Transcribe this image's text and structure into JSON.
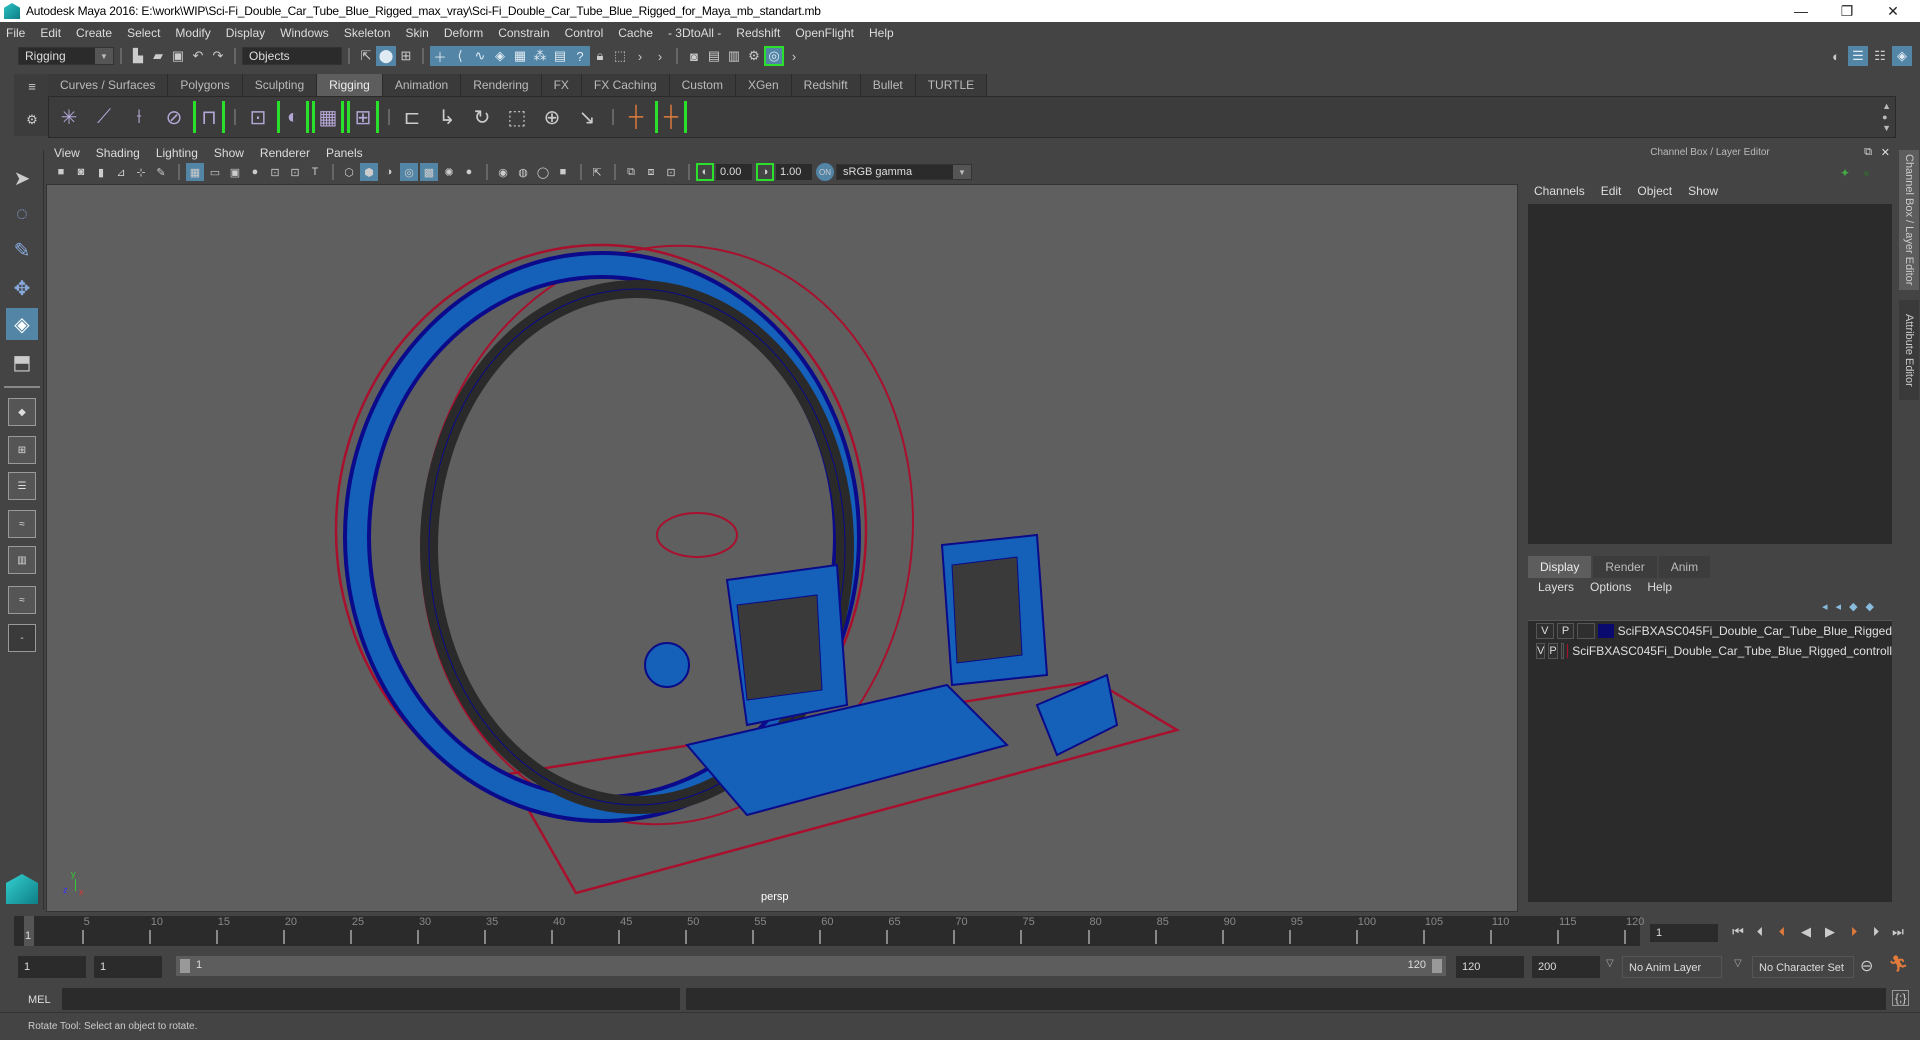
{
  "window": {
    "title": "Autodesk Maya 2016: E:\\work\\WIP\\Sci-Fi_Double_Car_Tube_Blue_Rigged_max_vray\\Sci-Fi_Double_Car_Tube_Blue_Rigged_for_Maya_mb_standart.mb",
    "controls": {
      "minimize": "—",
      "restore": "❐",
      "close": "✕"
    }
  },
  "menubar": [
    "File",
    "Edit",
    "Create",
    "Select",
    "Modify",
    "Display",
    "Windows",
    "Skeleton",
    "Skin",
    "Deform",
    "Constrain",
    "Control",
    "Cache",
    "- 3DtoAll -",
    "Redshift",
    "OpenFlight",
    "Help"
  ],
  "statusline": {
    "menu_set": "Rigging",
    "selection_mode": "Objects"
  },
  "shelf_tabs": [
    {
      "label": "Curves / Surfaces",
      "active": false
    },
    {
      "label": "Polygons",
      "active": false
    },
    {
      "label": "Sculpting",
      "active": false
    },
    {
      "label": "Rigging",
      "active": true
    },
    {
      "label": "Animation",
      "active": false
    },
    {
      "label": "Rendering",
      "active": false
    },
    {
      "label": "FX",
      "active": false
    },
    {
      "label": "FX Caching",
      "active": false
    },
    {
      "label": "Custom",
      "active": false
    },
    {
      "label": "XGen",
      "active": false
    },
    {
      "label": "Redshift",
      "active": false
    },
    {
      "label": "Bullet",
      "active": false
    },
    {
      "label": "TURTLE",
      "active": false
    }
  ],
  "viewport": {
    "menu": [
      "View",
      "Shading",
      "Lighting",
      "Show",
      "Renderer",
      "Panels"
    ],
    "exposure": "0.00",
    "gamma": "1.00",
    "color_space": "sRGB gamma",
    "camera_label": "persp",
    "axis": {
      "y": "y",
      "z": "z",
      "x": "x"
    }
  },
  "channel_box": {
    "title": "Channel Box / Layer Editor",
    "menu": [
      "Channels",
      "Edit",
      "Object",
      "Show"
    ]
  },
  "layer_editor": {
    "tabs": [
      {
        "label": "Display",
        "active": true
      },
      {
        "label": "Render",
        "active": false
      },
      {
        "label": "Anim",
        "active": false
      }
    ],
    "menu": [
      "Layers",
      "Options",
      "Help"
    ],
    "layers": [
      {
        "v": "V",
        "p": "P",
        "color": "#0a0a6e",
        "name": "SciFBXASC045Fi_Double_Car_Tube_Blue_Rigged"
      },
      {
        "v": "V",
        "p": "P",
        "color": "#a8102e",
        "name": "SciFBXASC045Fi_Double_Car_Tube_Blue_Rigged_controll"
      }
    ]
  },
  "side_tabs": [
    "Channel Box / Layer Editor",
    "Attribute Editor"
  ],
  "timeline": {
    "ticks": [
      5,
      10,
      15,
      20,
      25,
      30,
      35,
      40,
      45,
      50,
      55,
      60,
      65,
      70,
      75,
      80,
      85,
      90,
      95,
      100,
      105,
      110,
      115,
      120
    ],
    "start": 1,
    "end": 120,
    "current_frame": "1"
  },
  "range": {
    "start_time": "1",
    "playback_start": "1",
    "slider_start": "1",
    "slider_end": "120",
    "playback_end": "120",
    "end_time": "200",
    "anim_layer": "No Anim Layer",
    "character_set": "No Character Set"
  },
  "command_line": {
    "language": "MEL"
  },
  "status": {
    "help_line": "Rotate Tool: Select an object to rotate."
  },
  "colors": {
    "accent": "#5285a6",
    "control_curve": "#a8102e",
    "mesh_wire": "#0a0a8a",
    "mesh_fill": "#1560b8"
  }
}
